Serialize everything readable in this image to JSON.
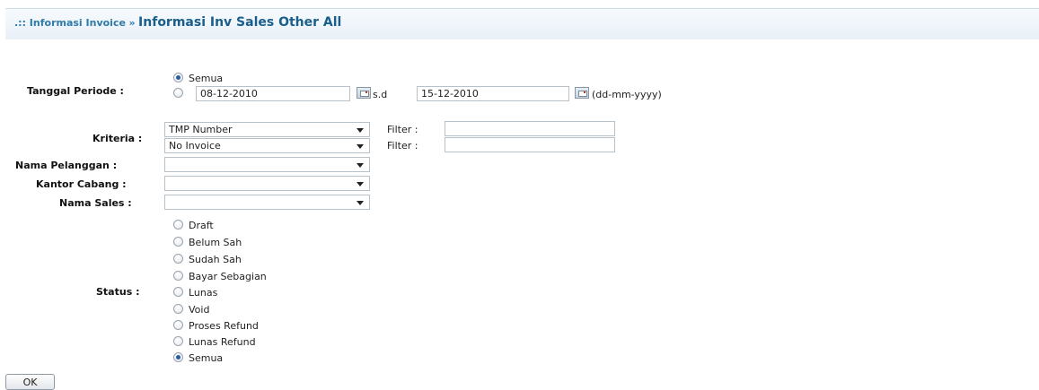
{
  "breadcrumb": {
    "parent": ".:: Informasi Invoice",
    "separator": "»",
    "title": "Informasi Inv Sales Other All"
  },
  "periode": {
    "label": "Tanggal Periode :",
    "option_all": "Semua",
    "date_from": "08-12-2010",
    "range_sep": "s.d",
    "date_to": "15-12-2010",
    "format_hint": "(dd-mm-yyyy)",
    "selected": "Semua"
  },
  "kriteria": {
    "label": "Kriteria :",
    "rows": [
      {
        "select": "TMP Number",
        "filter_label": "Filter :",
        "filter_value": ""
      },
      {
        "select": "No Invoice",
        "filter_label": "Filter :",
        "filter_value": ""
      }
    ]
  },
  "nama_pelanggan": {
    "label": "Nama Pelanggan :",
    "value": ""
  },
  "kantor_cabang": {
    "label": "Kantor Cabang :",
    "value": ""
  },
  "nama_sales": {
    "label": "Nama Sales :",
    "value": ""
  },
  "status": {
    "label": "Status :",
    "options": [
      "Draft",
      "Belum Sah",
      "Sudah Sah",
      "Bayar Sebagian",
      "Lunas",
      "Void",
      "Proses Refund",
      "Lunas Refund",
      "Semua"
    ],
    "selected": "Semua"
  },
  "ok_button": "OK"
}
